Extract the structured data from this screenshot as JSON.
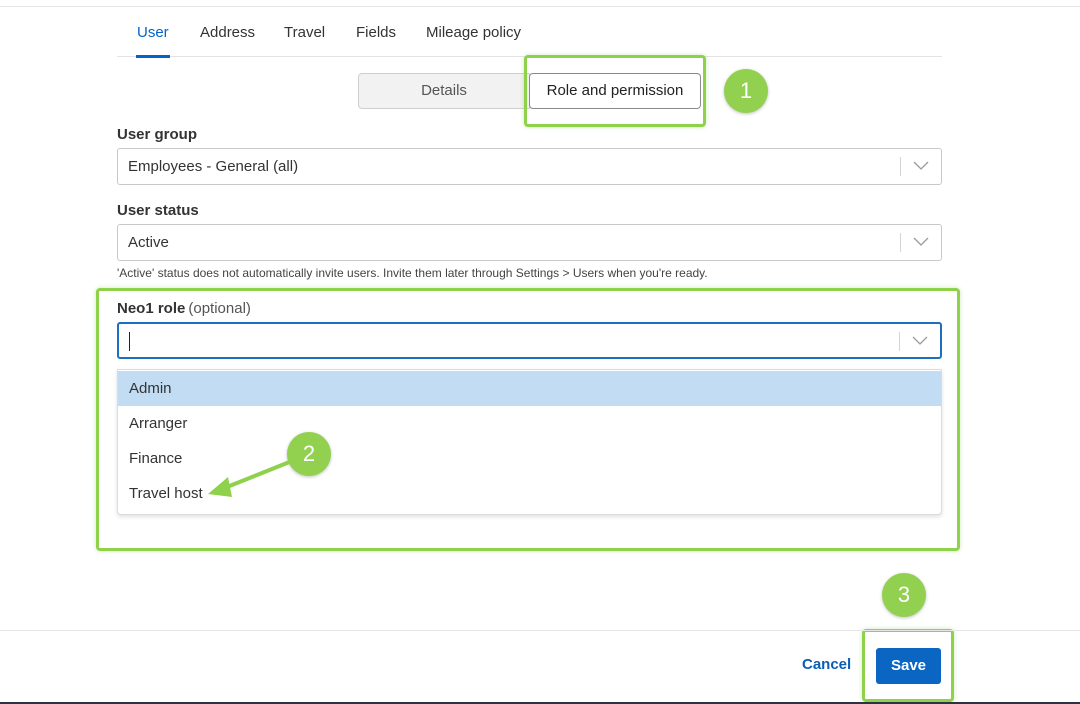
{
  "tabs": [
    {
      "label": "User",
      "active": true
    },
    {
      "label": "Address",
      "active": false
    },
    {
      "label": "Travel",
      "active": false
    },
    {
      "label": "Fields",
      "active": false
    },
    {
      "label": "Mileage policy",
      "active": false
    }
  ],
  "segmented": {
    "details_label": "Details",
    "role_label": "Role and permission",
    "selected": "Role and permission"
  },
  "user_group": {
    "label": "User group",
    "value": "Employees - General (all)"
  },
  "user_status": {
    "label": "User status",
    "value": "Active",
    "hint": "'Active' status does not automatically invite users. Invite them later through Settings > Users when you're ready."
  },
  "neo1_role": {
    "label": "Neo1 role",
    "optional": "(optional)",
    "value": "",
    "options": [
      "Admin",
      "Arranger",
      "Finance",
      "Travel host"
    ],
    "highlighted": "Admin"
  },
  "annotations": {
    "step1": "1",
    "step2": "2",
    "step3": "3",
    "color": "#92d050"
  },
  "footer": {
    "cancel_label": "Cancel",
    "save_label": "Save"
  },
  "colors": {
    "accent": "#0064c8",
    "highlight": "#c2dcf3",
    "annotation_green": "#8ed14b"
  }
}
